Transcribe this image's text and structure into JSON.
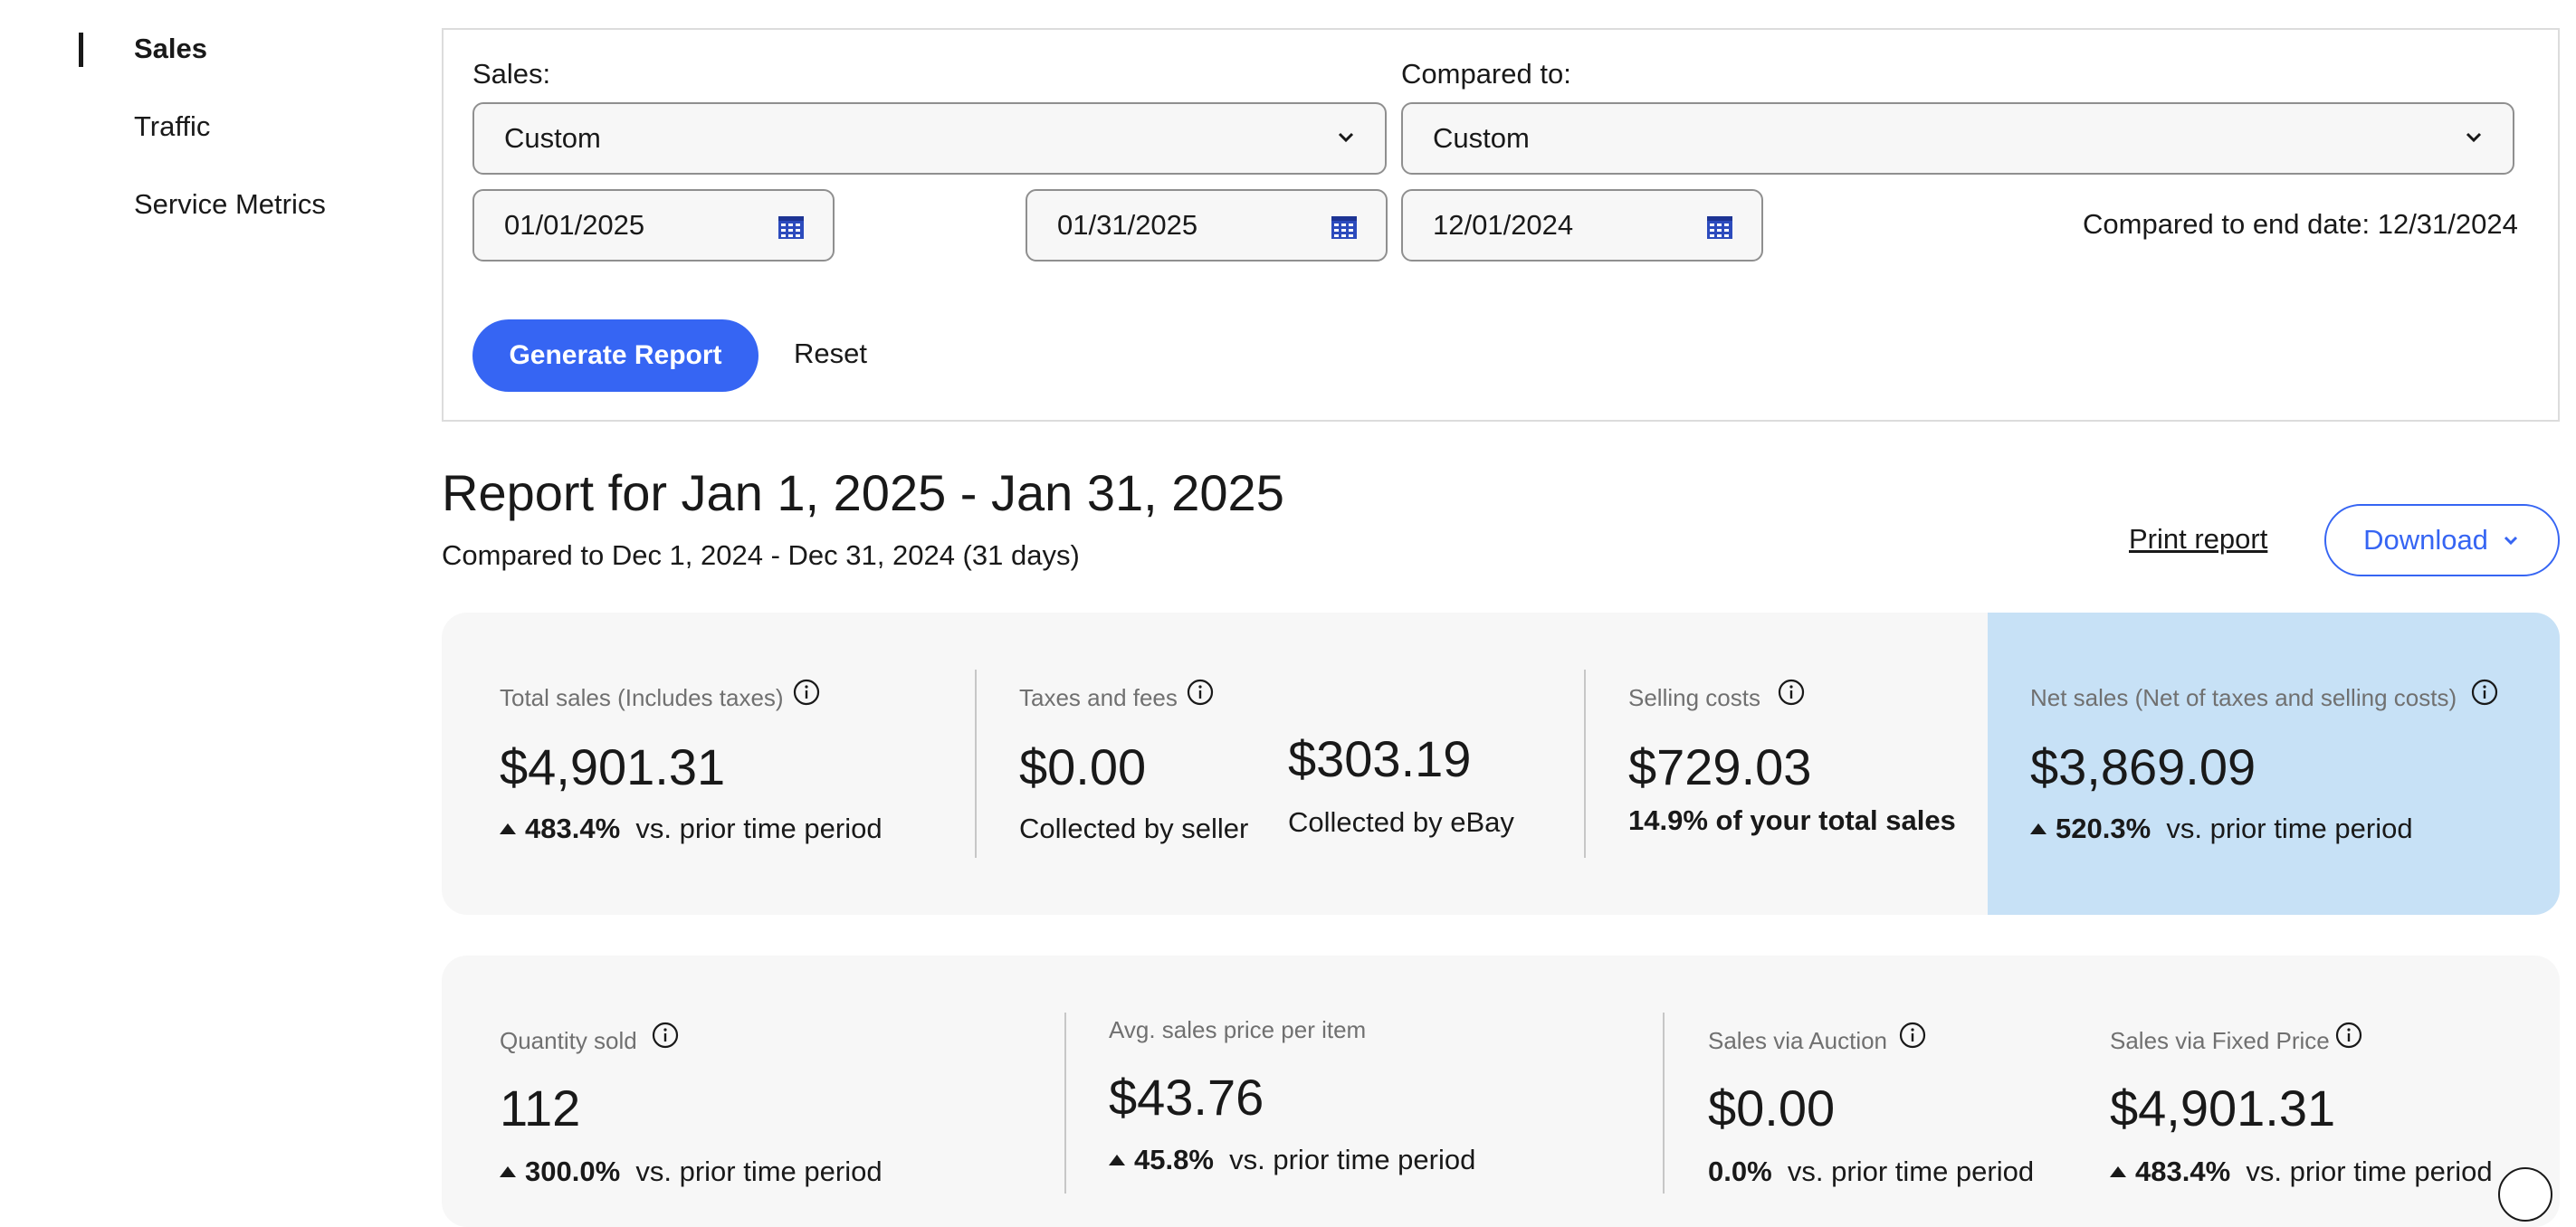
{
  "sidebar": {
    "items": [
      {
        "label": "Sales",
        "active": true
      },
      {
        "label": "Traffic",
        "active": false
      },
      {
        "label": "Service Metrics",
        "active": false
      }
    ]
  },
  "filters": {
    "sales_label": "Sales:",
    "sales_select": "Custom",
    "compared_label": "Compared to:",
    "compared_select": "Custom",
    "start_date": "01/01/2025",
    "end_date": "01/31/2025",
    "compare_start_date": "12/01/2024",
    "compare_end_text": "Compared to end date: 12/31/2024",
    "generate_label": "Generate Report",
    "reset_label": "Reset"
  },
  "report": {
    "title": "Report for Jan 1, 2025 - Jan 31, 2025",
    "subtitle": "Compared to Dec 1, 2024 - Dec 31, 2024 (31 days)",
    "print_label": "Print report",
    "download_label": "Download"
  },
  "summary": {
    "total_sales": {
      "label": "Total sales (Includes taxes)",
      "value": "$4,901.31",
      "change": "483.4%",
      "change_text": "vs. prior time period"
    },
    "taxes": {
      "label": "Taxes and fees",
      "seller_value": "$0.00",
      "seller_caption": "Collected by seller",
      "ebay_value": "$303.19",
      "ebay_caption": "Collected by eBay"
    },
    "selling_costs": {
      "label": "Selling costs",
      "value": "$729.03",
      "note": "14.9% of your total sales"
    },
    "net_sales": {
      "label": "Net sales (Net of taxes and selling costs)",
      "value": "$3,869.09",
      "change": "520.3%",
      "change_text": "vs. prior time period"
    }
  },
  "details": {
    "quantity": {
      "label": "Quantity sold",
      "value": "112",
      "change": "300.0%",
      "change_text": "vs. prior time period"
    },
    "avg_price": {
      "label": "Avg. sales price per item",
      "value": "$43.76",
      "change": "45.8%",
      "change_text": "vs. prior time period"
    },
    "auction": {
      "label": "Sales via Auction",
      "value": "$0.00",
      "change": "0.0%",
      "change_text": "vs. prior time period"
    },
    "fixed_price": {
      "label": "Sales via Fixed Price",
      "value": "$4,901.31",
      "change": "483.4%",
      "change_text": "vs. prior time period"
    }
  },
  "colors": {
    "accent": "#3665f3",
    "net_panel": "#c7e1f6",
    "card_bg": "#f7f7f7"
  },
  "icons": [
    "chevron-down-icon",
    "calendar-icon",
    "info-icon",
    "up-triangle-icon",
    "help-icon"
  ]
}
